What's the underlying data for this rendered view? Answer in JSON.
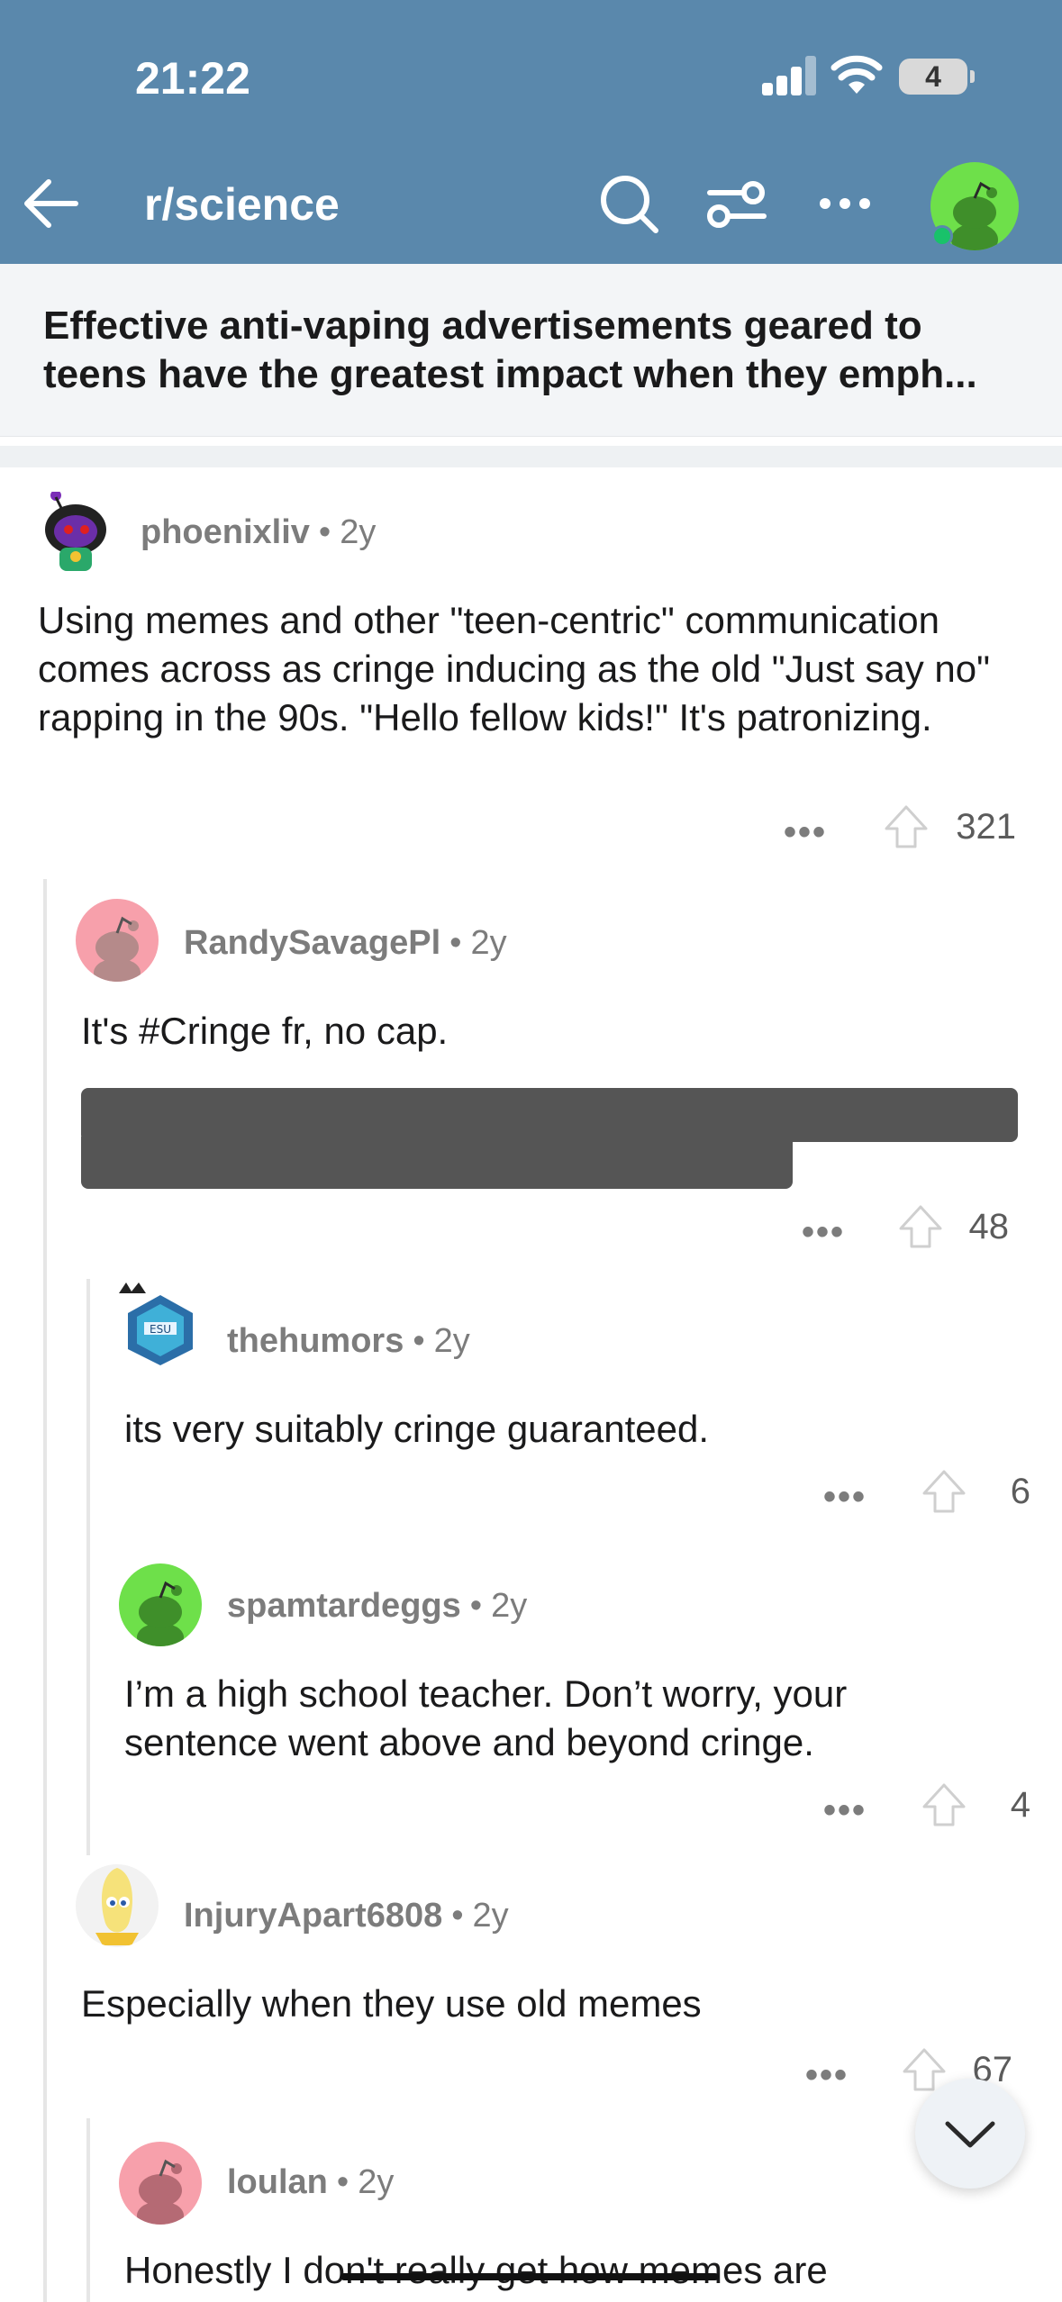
{
  "status_bar": {
    "time": "21:22",
    "battery": "4"
  },
  "header": {
    "subreddit": "r/science"
  },
  "post": {
    "title": "Effective anti-vaping advertisements geared to teens have the greatest impact when they emph..."
  },
  "comments": [
    {
      "author": "phoenixliv",
      "age": "2y",
      "body": "Using memes and other \"teen-centric\" communication comes across as cringe inducing as the old \"Just say no\" rapping in the 90s. \"Hello fellow kids!\"  It's patronizing.",
      "score": "321"
    },
    {
      "author": "RandySavagePl",
      "age": "2y",
      "body": "It's #Cringe fr, no cap.",
      "score": "48"
    },
    {
      "author": "thehumors",
      "age": "2y",
      "body": "its very suitably cringe guaranteed.",
      "score": "6"
    },
    {
      "author": "spamtardeggs",
      "age": "2y",
      "body": "I’m a high school teacher. Don’t worry, your sentence went above and beyond cringe.",
      "score": "4"
    },
    {
      "author": "InjuryApart6808",
      "age": "2y",
      "body": "Especially when they use old memes",
      "score": "67"
    },
    {
      "author": "loulan",
      "age": "2y",
      "body": "Honestly I don't really get how memes are"
    }
  ],
  "more_label": "•••",
  "separator": "•",
  "colors": {
    "header_bg": "#5a88ac",
    "title_bar_bg": "#f3f5f7",
    "avatar_green": "#6ee04a",
    "avatar_pink": "#f7a0ab"
  }
}
